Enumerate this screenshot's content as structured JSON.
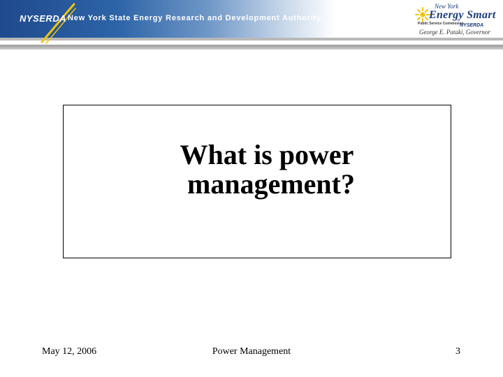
{
  "header": {
    "logo_text": "NYSERDA",
    "tagline": "New York State Energy Research and Development Authority",
    "brand_colors": {
      "banner_blue": "#1f4a8c",
      "swoosh_yellow": "#f2c20c",
      "logo_navy": "#1a3d7c"
    },
    "partner_logo": {
      "top_text": "New York",
      "main_text": "Energy Smart",
      "small_left_text": "Public Service Commission",
      "small_right_text": "NYSERDA",
      "governor_text": "George E. Pataki, Governor",
      "icon": "sun-icon"
    }
  },
  "slide": {
    "title_line1": "What is power",
    "title_line2": "management?"
  },
  "footer": {
    "date": "May 12, 2006",
    "title": "Power Management",
    "page_number": "3"
  }
}
